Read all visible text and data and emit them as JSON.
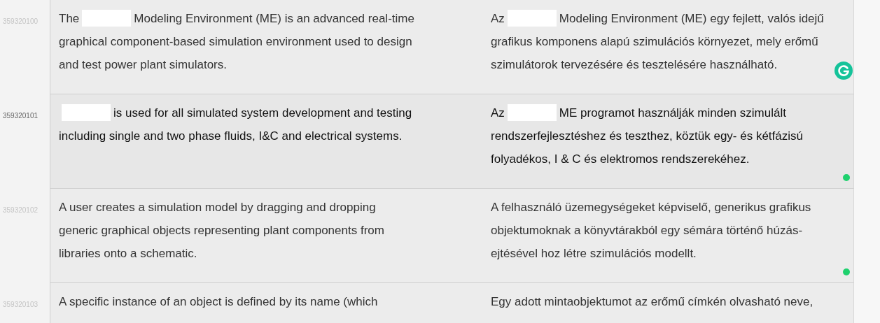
{
  "segments": [
    {
      "id": "359320100",
      "selected": false,
      "confirmed": false,
      "checker_icon": true,
      "source": [
        {
          "kind": "text",
          "text": "The"
        },
        {
          "kind": "redaction"
        },
        {
          "kind": "text",
          "text": "Modeling Environment (ME) is an advanced real-time graphical component-based simulation environment used to design and test power plant simulators."
        }
      ],
      "target": [
        {
          "kind": "text",
          "text": "Az"
        },
        {
          "kind": "redaction"
        },
        {
          "kind": "text",
          "text": "Modeling Environment (ME) egy fejlett, valós idejű grafikus komponens alapú szimulációs környezet, mely  erőmű szimulátorok tervezésére és tesztelésére használható."
        }
      ]
    },
    {
      "id": "359320101",
      "selected": true,
      "confirmed": true,
      "checker_icon": false,
      "source": [
        {
          "kind": "redaction"
        },
        {
          "kind": "text",
          "text": "is used for all simulated system development and testing including single and two phase fluids, I&C and electrical systems."
        }
      ],
      "target": [
        {
          "kind": "text",
          "text": "Az"
        },
        {
          "kind": "redaction"
        },
        {
          "kind": "text",
          "text": "ME programot használják minden szimulált rendszerfejlesztéshez és teszthez, köztük egy- és kétfázisú folyadékos, I & C és elektromos rendszerekéhez."
        }
      ]
    },
    {
      "id": "359320102",
      "selected": false,
      "confirmed": true,
      "checker_icon": false,
      "source": [
        {
          "kind": "text",
          "text": "A user creates a simulation model by dragging and dropping generic graphical objects representing plant components from libraries onto a schematic."
        }
      ],
      "target": [
        {
          "kind": "text",
          "text": "A felhasználó üzemegységeket képviselő, generikus grafikus objektumoknak a könyvtárakból egy sémára történő húzás-ejtésével hoz létre szimulációs modellt."
        }
      ]
    },
    {
      "id": "359320103",
      "selected": false,
      "confirmed": false,
      "checker_icon": false,
      "source": [
        {
          "kind": "text",
          "text": "A specific instance of an object is defined by its name (which"
        }
      ],
      "target": [
        {
          "kind": "text",
          "text": "Egy adott mintaobjektumot az erőmű címkén olvasható neve,"
        }
      ]
    }
  ]
}
